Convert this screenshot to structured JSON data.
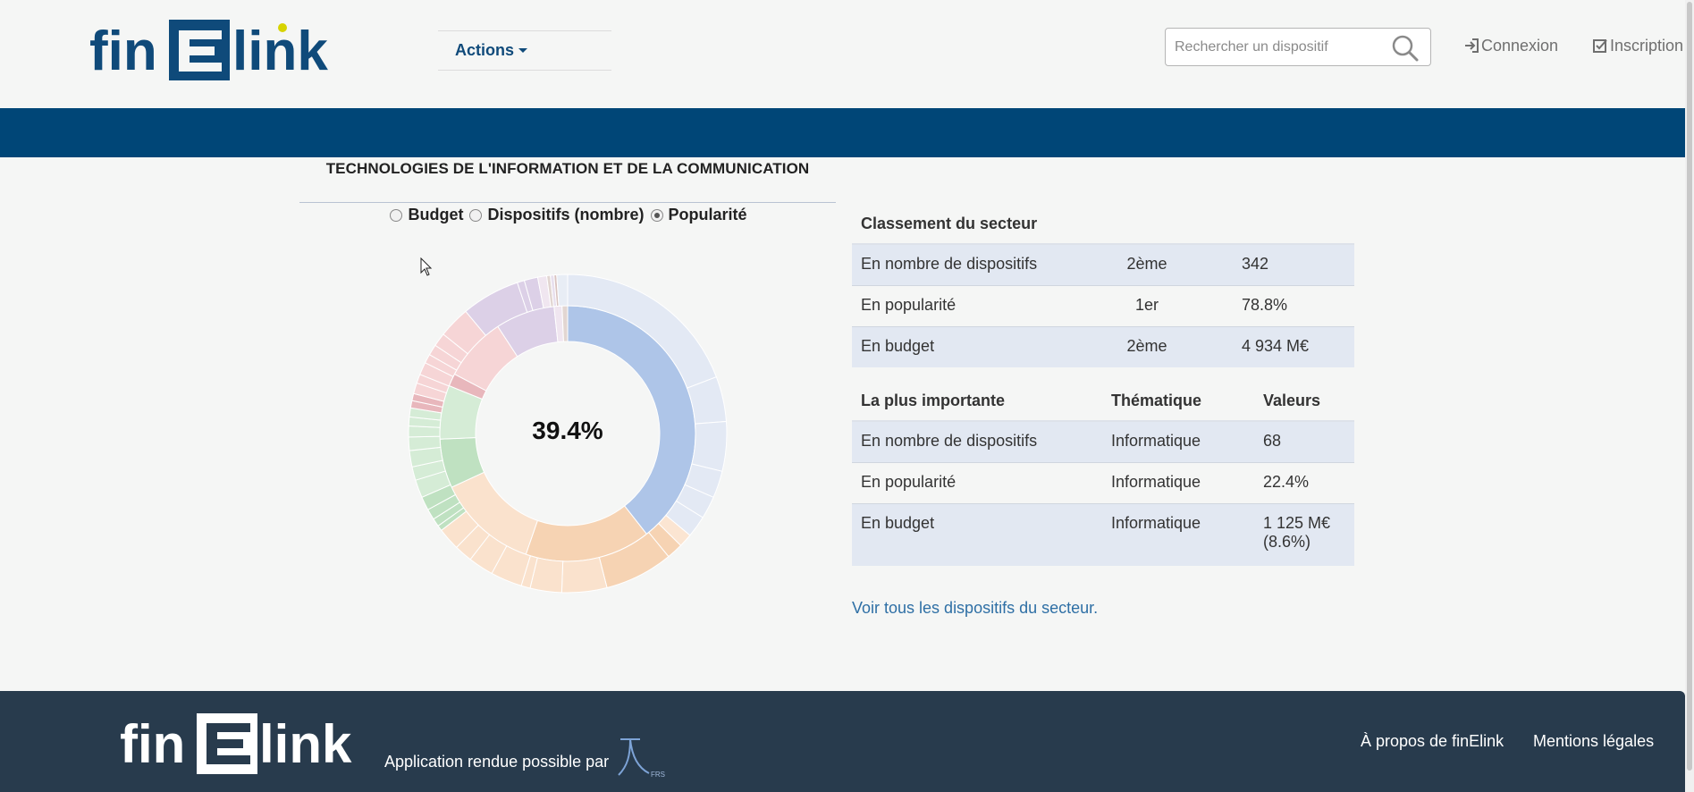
{
  "header": {
    "logo_text": "finElink",
    "actions_label": "Actions",
    "search": {
      "placeholder": "Rechercher un dispositif"
    },
    "login_label": "Connexion",
    "signup_label": "Inscription"
  },
  "sector": {
    "title": "TECHNOLOGIES DE L'INFORMATION ET DE LA COMMUNICATION",
    "radio_options": [
      {
        "label": "Budget",
        "checked": false
      },
      {
        "label": "Dispositifs (nombre)",
        "checked": false
      },
      {
        "label": "Popularité",
        "checked": true
      }
    ]
  },
  "chart_data": {
    "type": "pie",
    "center_label": "39.4%",
    "inner_ring": [
      {
        "value": 39.4,
        "color": "#aec5e8"
      },
      {
        "value": 15.9,
        "color": "#f6d3b3"
      },
      {
        "value": 12.8,
        "color": "#fae2cd"
      },
      {
        "value": 6.2,
        "color": "#bfe1c1"
      },
      {
        "value": 6.8,
        "color": "#d5ecd6"
      },
      {
        "value": 1.6,
        "color": "#e8b7bc"
      },
      {
        "value": 8.1,
        "color": "#f6d5d6"
      },
      {
        "value": 7.5,
        "color": "#dcd0e7"
      },
      {
        "value": 1.0,
        "color": "#f0e6f0"
      },
      {
        "value": 0.7,
        "color": "#e2d6d2"
      }
    ],
    "outer_ring": [
      {
        "value": 21.0,
        "color": "#e3e9f4"
      },
      {
        "value": 5.0,
        "color": "#e3e9f4"
      },
      {
        "value": 5.5,
        "color": "#e3e9f4"
      },
      {
        "value": 3.0,
        "color": "#e3e9f4"
      },
      {
        "value": 2.5,
        "color": "#e3e9f4"
      },
      {
        "value": 2.4,
        "color": "#e3e9f4"
      },
      {
        "value": 1.5,
        "color": "#fbe5d2"
      },
      {
        "value": 1.8,
        "color": "#f6d3b3"
      },
      {
        "value": 7.6,
        "color": "#f6d3b3"
      },
      {
        "value": 5.0,
        "color": "#fae2cd"
      },
      {
        "value": 3.5,
        "color": "#fae2cd"
      },
      {
        "value": 1.0,
        "color": "#fae2cd"
      },
      {
        "value": 3.5,
        "color": "#fae2cd"
      },
      {
        "value": 2.8,
        "color": "#fae2cd"
      },
      {
        "value": 2.0,
        "color": "#fae2cd"
      },
      {
        "value": 2.5,
        "color": "#fae2cd"
      },
      {
        "value": 0.6,
        "color": "#bfe1c1"
      },
      {
        "value": 0.9,
        "color": "#bfe1c1"
      },
      {
        "value": 1.2,
        "color": "#bfe1c1"
      },
      {
        "value": 1.5,
        "color": "#bfe1c1"
      },
      {
        "value": 2.0,
        "color": "#d5ecd6"
      },
      {
        "value": 1.5,
        "color": "#d5ecd6"
      },
      {
        "value": 1.8,
        "color": "#d5ecd6"
      },
      {
        "value": 1.5,
        "color": "#d5ecd6"
      },
      {
        "value": 1.2,
        "color": "#d5ecd6"
      },
      {
        "value": 1.0,
        "color": "#d5ecd6"
      },
      {
        "value": 1.0,
        "color": "#d5ecd6"
      },
      {
        "value": 0.8,
        "color": "#e8b7bc"
      },
      {
        "value": 0.8,
        "color": "#e8b7bc"
      },
      {
        "value": 1.2,
        "color": "#f6d5d6"
      },
      {
        "value": 1.0,
        "color": "#f6d5d6"
      },
      {
        "value": 1.4,
        "color": "#f6d5d6"
      },
      {
        "value": 1.0,
        "color": "#f6d5d6"
      },
      {
        "value": 1.2,
        "color": "#f6d5d6"
      },
      {
        "value": 1.5,
        "color": "#f6d5d6"
      },
      {
        "value": 3.5,
        "color": "#f6d5d6"
      },
      {
        "value": 6.5,
        "color": "#dcd0e7"
      },
      {
        "value": 0.8,
        "color": "#dcd0e7"
      },
      {
        "value": 1.5,
        "color": "#dcd0e7"
      },
      {
        "value": 1.0,
        "color": "#f0e6f0"
      },
      {
        "value": 0.4,
        "color": "#e2d6d2"
      },
      {
        "value": 0.4,
        "color": "#e8e0ee"
      },
      {
        "value": 0.3,
        "color": "#d9c3c0"
      },
      {
        "value": 1.2,
        "color": "#e8edf5"
      }
    ]
  },
  "ranking": {
    "heading": "Classement du secteur",
    "rows": [
      {
        "label": "En nombre de dispositifs",
        "rank": "2ème",
        "value": "342"
      },
      {
        "label": "En popularité",
        "rank": "1er",
        "value": "78.8%"
      },
      {
        "label": "En budget",
        "rank": "2ème",
        "value": "4 934 M€"
      }
    ]
  },
  "top": {
    "headers": [
      "La plus importante",
      "Thématique",
      "Valeurs"
    ],
    "rows": [
      {
        "label": "En nombre de dispositifs",
        "theme": "Informatique",
        "value": "68",
        "value2": ""
      },
      {
        "label": "En popularité",
        "theme": "Informatique",
        "value": "22.4%",
        "value2": ""
      },
      {
        "label": "En budget",
        "theme": "Informatique",
        "value": "1 125 M€",
        "value2": "(8.6%)"
      }
    ]
  },
  "sector_link": "Voir tous les dispositifs du secteur.",
  "footer": {
    "logo_text": "finElink",
    "app_text": "Application rendue possible par",
    "about_label": "À propos de finElink",
    "legal_label": "Mentions légales",
    "partner_logo_text": "FRS"
  }
}
